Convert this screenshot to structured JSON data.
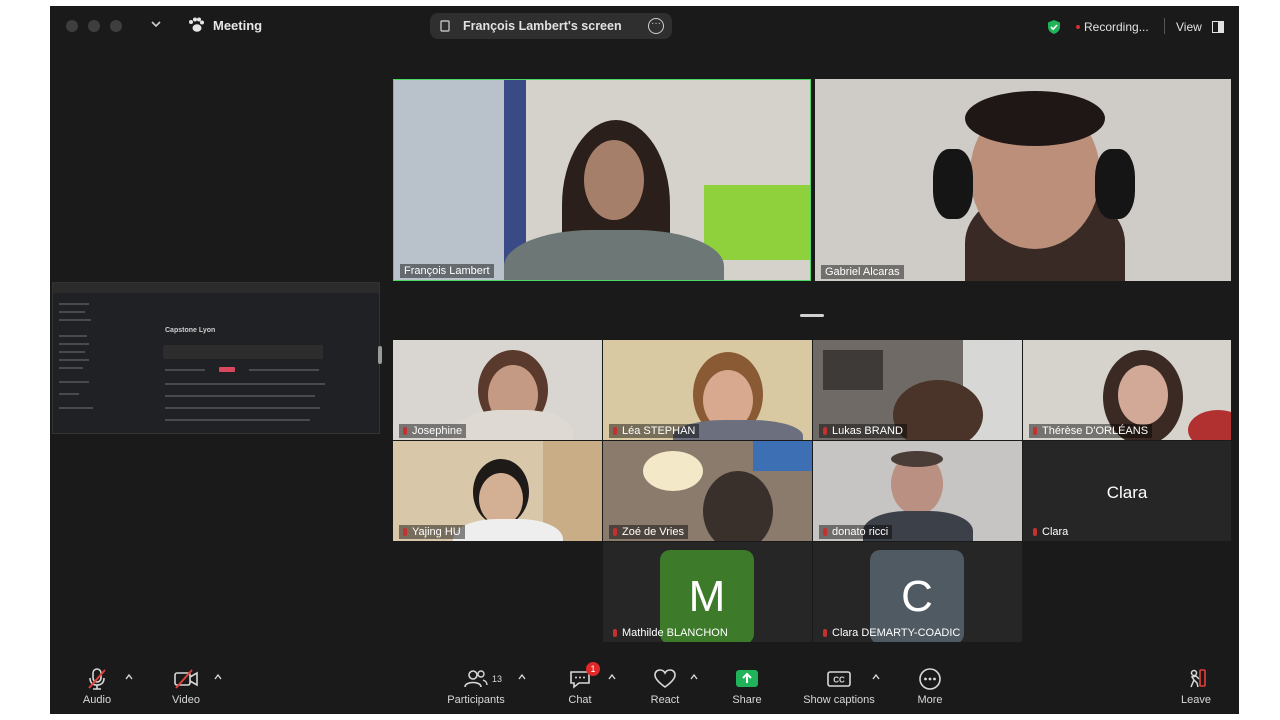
{
  "window": {
    "title": "Meeting",
    "share_label": "François Lambert's screen",
    "recording": "Recording...",
    "view": "View"
  },
  "screen_share": {
    "heading": "Capstone Lyon"
  },
  "speakers": [
    {
      "name": "François Lambert",
      "active": true
    },
    {
      "name": "Gabriel Alcaras",
      "active": false
    }
  ],
  "gallery": [
    {
      "name": "Josephine"
    },
    {
      "name": "Léa STEPHAN"
    },
    {
      "name": "Lukas BRAND"
    },
    {
      "name": "Thérèse D'ORLÉANS"
    },
    {
      "name": "Yajing HU"
    },
    {
      "name": "Zoé de Vries"
    },
    {
      "name": "donato ricci"
    },
    {
      "name": "Clara",
      "big_name": "Clara"
    }
  ],
  "avatars": [
    {
      "name": "Mathilde BLANCHON",
      "initial": "M",
      "color": "#3d7a2a"
    },
    {
      "name": "Clara DEMARTY-COADIC",
      "initial": "C",
      "color": "#4f5a63"
    }
  ],
  "toolbar": {
    "audio": "Audio",
    "video": "Video",
    "participants": "Participants",
    "participants_count": "13",
    "chat": "Chat",
    "chat_badge": "1",
    "react": "React",
    "share": "Share",
    "captions": "Show captions",
    "more": "More",
    "leave": "Leave"
  },
  "colors": {
    "active_speaker_border": "#4cd964",
    "share_green": "#21b35a",
    "mic_muted": "#c6302f"
  }
}
